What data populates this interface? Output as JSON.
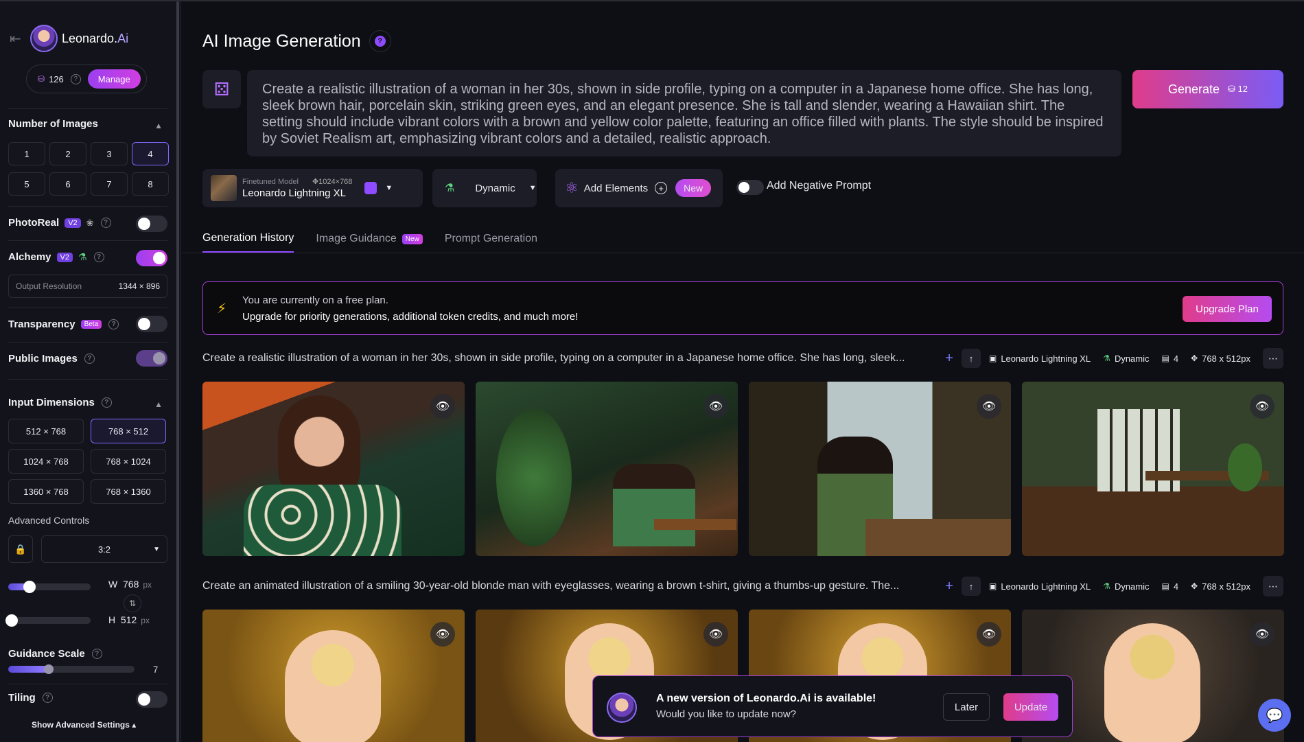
{
  "sidebar": {
    "brand": "Leonardo.",
    "brand_ai": "Ai",
    "tokens": "126",
    "manage_label": "Manage",
    "num_images_title": "Number of Images",
    "num_images": [
      "1",
      "2",
      "3",
      "4",
      "5",
      "6",
      "7",
      "8"
    ],
    "num_images_selected": "4",
    "photoreal_label": "PhotoReal",
    "v2": "V2",
    "alchemy_label": "Alchemy",
    "output_res_label": "Output Resolution",
    "output_res_value": "1344 × 896",
    "transparency_label": "Transparency",
    "beta": "Beta",
    "public_images_label": "Public Images",
    "input_dims_title": "Input Dimensions",
    "dims": [
      "512 × 768",
      "768 × 512",
      "1024 × 768",
      "768 × 1024",
      "1360 × 768",
      "768 × 1360"
    ],
    "dims_selected": "768 × 512",
    "advanced_controls": "Advanced Controls",
    "ratio": "3:2",
    "w_label": "W",
    "w_value": "768",
    "h_label": "H",
    "h_value": "512",
    "px": "px",
    "guidance_label": "Guidance Scale",
    "guidance_value": "7",
    "tiling_label": "Tiling",
    "show_advanced": "Show Advanced Settings"
  },
  "main": {
    "title": "AI Image Generation",
    "prompt": "Create a realistic illustration of a woman in her 30s, shown in side profile, typing on a computer in a Japanese home office. She has long, sleek brown hair, porcelain skin, striking green eyes, and an elegant presence. She is tall and slender, wearing a Hawaiian shirt. The setting should include vibrant colors with a brown and yellow color palette, featuring an office filled with plants. The style should be inspired by Soviet Realism art, emphasizing vibrant colors and a detailed, realistic approach.",
    "generate_label": "Generate",
    "generate_tokens": "12",
    "model_caption": "Finetuned Model",
    "model_dims": "1024×768",
    "model_name": "Leonardo Lightning XL",
    "style": "Dynamic",
    "add_elements": "Add Elements",
    "new": "New",
    "negative_prompt": "Add Negative Prompt",
    "tabs": [
      "Generation History",
      "Image Guidance",
      "Prompt Generation"
    ],
    "banner_line1": "You are currently on a free plan.",
    "banner_line2": "Upgrade for priority generations, additional token credits, and much more!",
    "upgrade_label": "Upgrade Plan",
    "generations": [
      {
        "prompt": "Create a realistic illustration of a woman in her 30s, shown in side profile, typing on a computer in a Japanese home office. She has long, sleek...",
        "model": "Leonardo Lightning XL",
        "style": "Dynamic",
        "count": "4",
        "size": "768 x 512px"
      },
      {
        "prompt": "Create an animated illustration of a smiling 30-year-old blonde man with eyeglasses, wearing a brown t-shirt, giving a thumbs-up gesture. The...",
        "model": "Leonardo Lightning XL",
        "style": "Dynamic",
        "count": "4",
        "size": "768 x 512px"
      }
    ]
  },
  "toast": {
    "title": "A new version of Leonardo.Ai is available!",
    "subtitle": "Would you like to update now?",
    "later": "Later",
    "update": "Update"
  },
  "colors": {
    "accent": "#8f4bff",
    "generate_gradient_start": "#e03c8a",
    "generate_gradient_end": "#7a5cf5",
    "background": "#0e0f14"
  }
}
